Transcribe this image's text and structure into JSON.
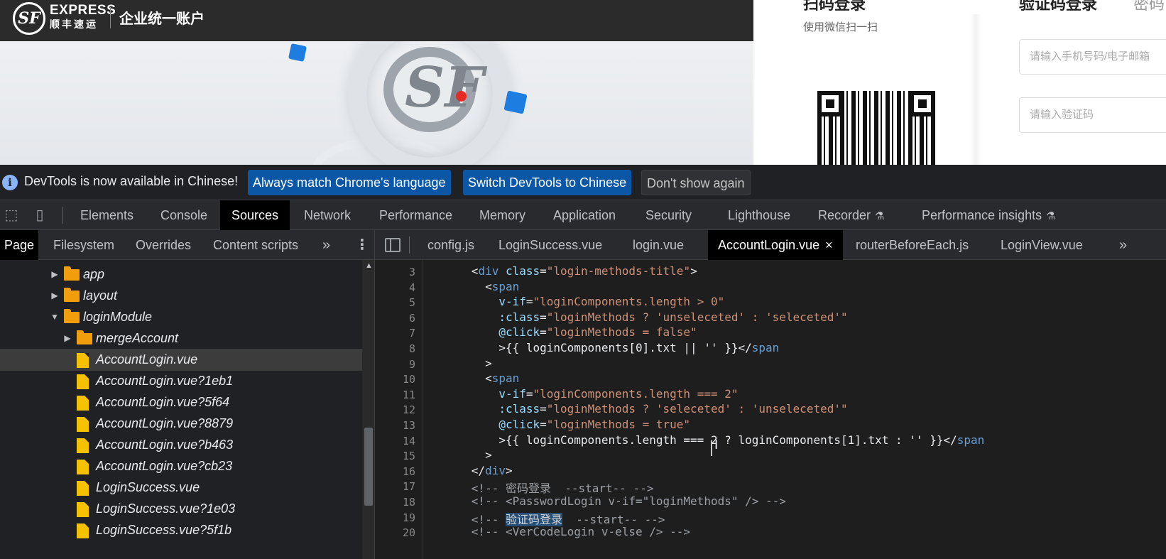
{
  "webpage": {
    "logo_mark": "SF",
    "logo_express": "EXPRESS",
    "logo_cn": "顺丰速运",
    "portal_name": "企业统一账户",
    "qr_title": "扫码登录",
    "qr_subtitle": "使用微信扫一扫",
    "code_login_title": "验证码登录",
    "other_login_title": "密码",
    "phone_placeholder": "请输入手机号码/电子邮箱",
    "code_placeholder": "请输入验证码"
  },
  "infobar": {
    "icon": "info-icon",
    "message": "DevTools is now available in Chinese!",
    "match_button": "Always match Chrome's language",
    "switch_button": "Switch DevTools to Chinese",
    "dismiss_button": "Don't show again"
  },
  "main_tabs": {
    "items": [
      "Elements",
      "Console",
      "Sources",
      "Network",
      "Performance",
      "Memory",
      "Application",
      "Security",
      "Lighthouse",
      "Recorder",
      "Performance insights"
    ],
    "active": "Sources"
  },
  "sub_tabs": {
    "items": [
      "Page",
      "Filesystem",
      "Overrides",
      "Content scripts"
    ],
    "active": "Page",
    "more": "»",
    "menu": "⋮"
  },
  "editor_tabs": {
    "items": [
      "config.js",
      "LoginSuccess.vue",
      "login.vue",
      "AccountLogin.vue",
      "routerBeforeEach.js",
      "LoginView.vue"
    ],
    "active": "AccountLogin.vue",
    "close": "×",
    "more": "»"
  },
  "file_tree": {
    "rows": [
      {
        "label": "app",
        "type": "folder",
        "expanded": false
      },
      {
        "label": "layout",
        "type": "folder",
        "expanded": false
      },
      {
        "label": "loginModule",
        "type": "folder",
        "expanded": true
      },
      {
        "label": "mergeAccount",
        "type": "folder",
        "expanded": false
      },
      {
        "label": "AccountLogin.vue",
        "type": "file",
        "selected": true
      },
      {
        "label": "AccountLogin.vue?1eb1",
        "type": "file"
      },
      {
        "label": "AccountLogin.vue?5f64",
        "type": "file"
      },
      {
        "label": "AccountLogin.vue?8879",
        "type": "file"
      },
      {
        "label": "AccountLogin.vue?b463",
        "type": "file"
      },
      {
        "label": "AccountLogin.vue?cb23",
        "type": "file"
      },
      {
        "label": "LoginSuccess.vue",
        "type": "file"
      },
      {
        "label": "LoginSuccess.vue?1e03",
        "type": "file"
      },
      {
        "label": "LoginSuccess.vue?5f1b",
        "type": "file"
      }
    ]
  },
  "code": {
    "lines": [
      {
        "no": "3",
        "tokens": [
          [
            "punc",
            "      <"
          ],
          [
            "tag",
            "div"
          ],
          [
            "attr",
            " class"
          ],
          [
            "punc",
            "="
          ],
          [
            "str",
            "\"login-methods-title\""
          ],
          [
            "punc",
            ">"
          ]
        ]
      },
      {
        "no": "4",
        "tokens": [
          [
            "punc",
            "        <"
          ],
          [
            "tag",
            "span"
          ]
        ]
      },
      {
        "no": "5",
        "tokens": [
          [
            "attr",
            "          v-if"
          ],
          [
            "punc",
            "="
          ],
          [
            "str",
            "\"loginComponents.length > 0\""
          ]
        ]
      },
      {
        "no": "6",
        "tokens": [
          [
            "attr",
            "          :class"
          ],
          [
            "punc",
            "="
          ],
          [
            "str",
            "\"loginMethods ? 'unseleceted' : 'seleceted'\""
          ]
        ]
      },
      {
        "no": "7",
        "tokens": [
          [
            "attr",
            "          @click"
          ],
          [
            "punc",
            "="
          ],
          [
            "str",
            "\"loginMethods = false\""
          ]
        ]
      },
      {
        "no": "8",
        "tokens": [
          [
            "punc",
            "          >{{ loginComponents[0].txt || '' }}</"
          ],
          [
            "tag",
            "span"
          ]
        ]
      },
      {
        "no": "9",
        "tokens": [
          [
            "punc",
            "        >"
          ]
        ]
      },
      {
        "no": "10",
        "tokens": [
          [
            "punc",
            "        <"
          ],
          [
            "tag",
            "span"
          ]
        ]
      },
      {
        "no": "11",
        "tokens": [
          [
            "attr",
            "          v-if"
          ],
          [
            "punc",
            "="
          ],
          [
            "str",
            "\"loginComponents.length === 2\""
          ]
        ]
      },
      {
        "no": "12",
        "tokens": [
          [
            "attr",
            "          :class"
          ],
          [
            "punc",
            "="
          ],
          [
            "str",
            "\"loginMethods ? 'seleceted' : 'unseleceted'\""
          ]
        ]
      },
      {
        "no": "13",
        "tokens": [
          [
            "attr",
            "          @click"
          ],
          [
            "punc",
            "="
          ],
          [
            "str",
            "\"loginMethods = true\""
          ]
        ]
      },
      {
        "no": "14",
        "tokens": [
          [
            "punc",
            "          >{{ loginComponents.length === 2 ? loginComponents[1].txt : '' }}</"
          ],
          [
            "tag",
            "span"
          ]
        ]
      },
      {
        "no": "15",
        "tokens": [
          [
            "punc",
            "        >"
          ]
        ]
      },
      {
        "no": "16",
        "tokens": [
          [
            "punc",
            "      </"
          ],
          [
            "tag",
            "div"
          ],
          [
            "punc",
            ">"
          ]
        ]
      },
      {
        "no": "17",
        "tokens": [
          [
            "cmt",
            "      <!-- 密码登录  --start-- -->"
          ]
        ]
      },
      {
        "no": "18",
        "tokens": [
          [
            "cmt",
            "      <!-- <PasswordLogin v-if=\"loginMethods\" /> -->"
          ]
        ]
      },
      {
        "no": "19",
        "tokens": [
          [
            "cmt",
            "      <!-- "
          ],
          [
            "hl",
            "验证码登录"
          ],
          [
            "cmt",
            "  --start-- -->"
          ]
        ]
      },
      {
        "no": "20",
        "tokens": [
          [
            "cmt",
            "      <!-- <VerCodeLogin v-else /> -->"
          ]
        ]
      }
    ]
  },
  "colors": {
    "devtools_bg": "#202124",
    "editor_bg": "#1e1e1e",
    "accent_button": "#0b57a5",
    "folder": "#f29d0b",
    "file": "#f6c100"
  }
}
